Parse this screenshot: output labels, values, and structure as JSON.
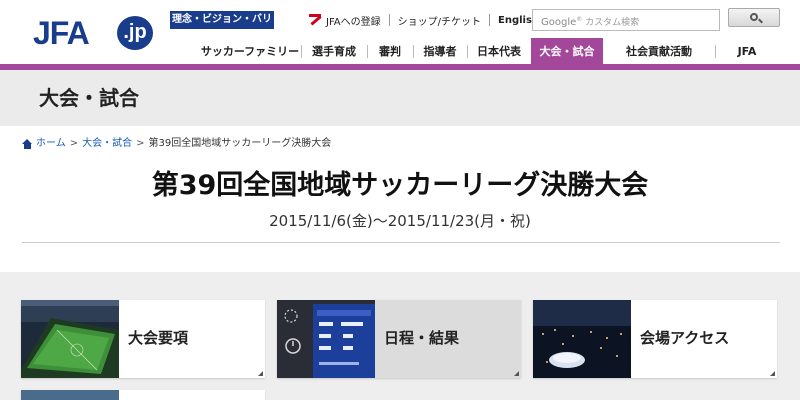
{
  "header": {
    "logo": "JFA.jp",
    "philosophy_button": "理念・ビジョン・バリュー",
    "top_links": {
      "register": "JFAへの登録",
      "shop": "ショップ/チケット",
      "english": "English"
    },
    "search": {
      "google_label": "Google",
      "placeholder": "カスタム検索"
    }
  },
  "nav": [
    {
      "label": "サッカーファミリー",
      "active": false
    },
    {
      "label": "選手育成",
      "active": false
    },
    {
      "label": "審判",
      "active": false
    },
    {
      "label": "指導者",
      "active": false
    },
    {
      "label": "日本代表",
      "active": false
    },
    {
      "label": "大会・試合",
      "active": true
    },
    {
      "label": "社会貢献活動",
      "active": false
    },
    {
      "label": "JFA",
      "active": false
    }
  ],
  "section": {
    "title": "大会・試合"
  },
  "breadcrumb": {
    "home": "ホーム",
    "parent": "大会・試合",
    "current": "第39回全国地域サッカーリーグ決勝大会",
    "separator": ">"
  },
  "page": {
    "title": "第39回全国地域サッカーリーグ決勝大会",
    "date": "2015/11/6(金)～2015/11/23(月・祝)"
  },
  "cards": [
    {
      "label": "大会要項",
      "thumb": "stadium-photo"
    },
    {
      "label": "日程・結果",
      "thumb": "scoreboard-photo"
    },
    {
      "label": "会場アクセス",
      "thumb": "night-city-photo"
    }
  ],
  "colors": {
    "brand_blue": "#1a3c8c",
    "accent_purple": "#a3479a",
    "band_gray": "#ebebeb"
  }
}
